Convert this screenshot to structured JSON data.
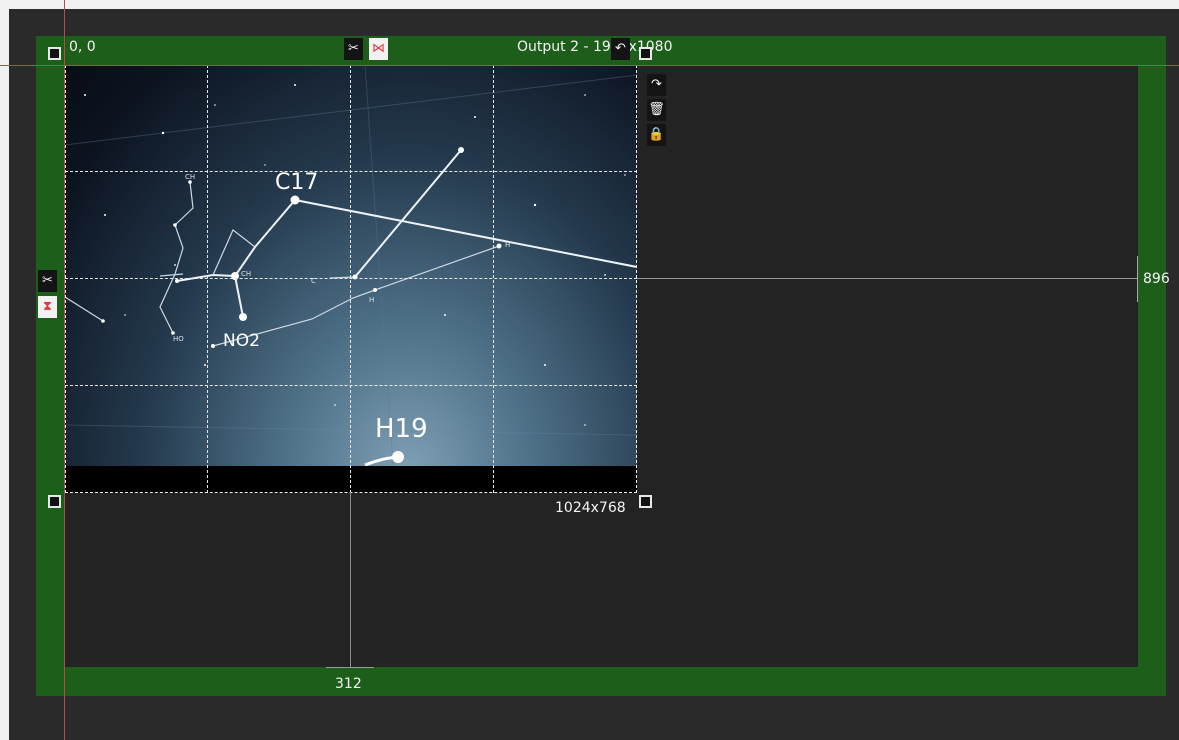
{
  "output": {
    "origin_label": "0, 0",
    "title": "Output 2 - 1920x1080",
    "size_label": "1024x768",
    "right_guide_label": "896",
    "bottom_guide_label": "312"
  },
  "image": {
    "labels": [
      "C17",
      "NO2",
      "H19"
    ]
  },
  "colors": {
    "frame_green": "#1d5e1a",
    "canvas_dark": "#232323",
    "guide_red": "#b84a4a"
  },
  "icons": {
    "top_toolbar": [
      "scissors-icon",
      "flip-horizontal-icon",
      "undo-icon"
    ],
    "right_toolbar": [
      "redo-icon",
      "trash-icon",
      "lock-icon"
    ],
    "left_toolbar": [
      "scissors-icon",
      "flip-vertical-icon"
    ]
  }
}
